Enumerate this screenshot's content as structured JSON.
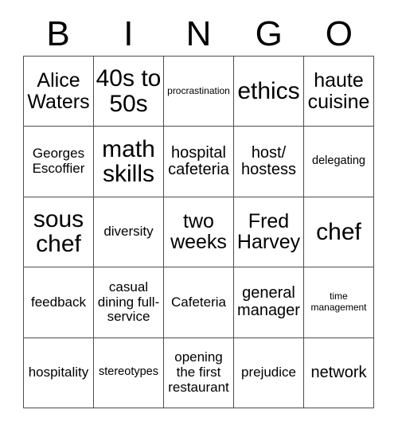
{
  "card": {
    "header_letters": [
      "B",
      "I",
      "N",
      "G",
      "O"
    ],
    "grid_rows": 5,
    "grid_cols": 5,
    "border_color": "#4d4d4d",
    "text_color": "#000000",
    "background_color": "#ffffff",
    "cells": [
      [
        {
          "text": "Alice Waters",
          "size": "xl"
        },
        {
          "text": "40s to 50s",
          "size": "xxl"
        },
        {
          "text": "procrastination",
          "size": "xs"
        },
        {
          "text": "ethics",
          "size": "xxl"
        },
        {
          "text": "haute cuisine",
          "size": "xl"
        }
      ],
      [
        {
          "text": "Georges Escoffier",
          "size": "m"
        },
        {
          "text": "math skills",
          "size": "xxl"
        },
        {
          "text": "hospital cafeteria",
          "size": "l"
        },
        {
          "text": "host/ hostess",
          "size": "l"
        },
        {
          "text": "delegating",
          "size": "s"
        }
      ],
      [
        {
          "text": "sous chef",
          "size": "xxl"
        },
        {
          "text": "diversity",
          "size": "m"
        },
        {
          "text": "two weeks",
          "size": "xl"
        },
        {
          "text": "Fred Harvey",
          "size": "xl"
        },
        {
          "text": "chef",
          "size": "xxl"
        }
      ],
      [
        {
          "text": "feedback",
          "size": "m"
        },
        {
          "text": "casual dining full-service",
          "size": "m"
        },
        {
          "text": "Cafeteria",
          "size": "m"
        },
        {
          "text": "general manager",
          "size": "l"
        },
        {
          "text": "time management",
          "size": "xs"
        }
      ],
      [
        {
          "text": "hospitality",
          "size": "m"
        },
        {
          "text": "stereotypes",
          "size": "s"
        },
        {
          "text": "opening the first restaurant",
          "size": "m"
        },
        {
          "text": "prejudice",
          "size": "m"
        },
        {
          "text": "network",
          "size": "l"
        }
      ]
    ]
  }
}
